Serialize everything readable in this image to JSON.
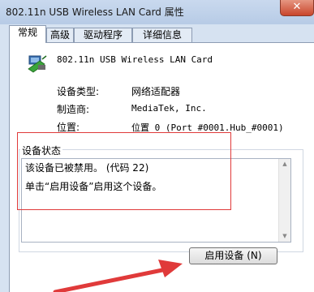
{
  "window": {
    "title": "802.11n USB Wireless LAN Card 属性",
    "close_label": "✕"
  },
  "tabs": [
    {
      "label": "常规",
      "active": true
    },
    {
      "label": "高级",
      "active": false
    },
    {
      "label": "驱动程序",
      "active": false
    },
    {
      "label": "详细信息",
      "active": false
    }
  ],
  "device": {
    "name": "802.11n USB Wireless LAN Card",
    "icon": "network-adapter-icon",
    "properties": {
      "type_label": "设备类型:",
      "type_value": "网络适配器",
      "maker_label": "制造商:",
      "maker_value": "MediaTek, Inc.",
      "location_label": "位置:",
      "location_value": "位置 0 (Port_#0001.Hub_#0001)"
    }
  },
  "status": {
    "label": "设备状态",
    "line1": "该设备已被禁用。 (代码 22)",
    "line2": "单击“启用设备”启用这个设备。"
  },
  "enable_button": {
    "label": "启用设备 (N)"
  },
  "colors": {
    "annotation": "#e03a3a",
    "title_bar": "#c9d9ee",
    "close_button": "#c9462c"
  }
}
